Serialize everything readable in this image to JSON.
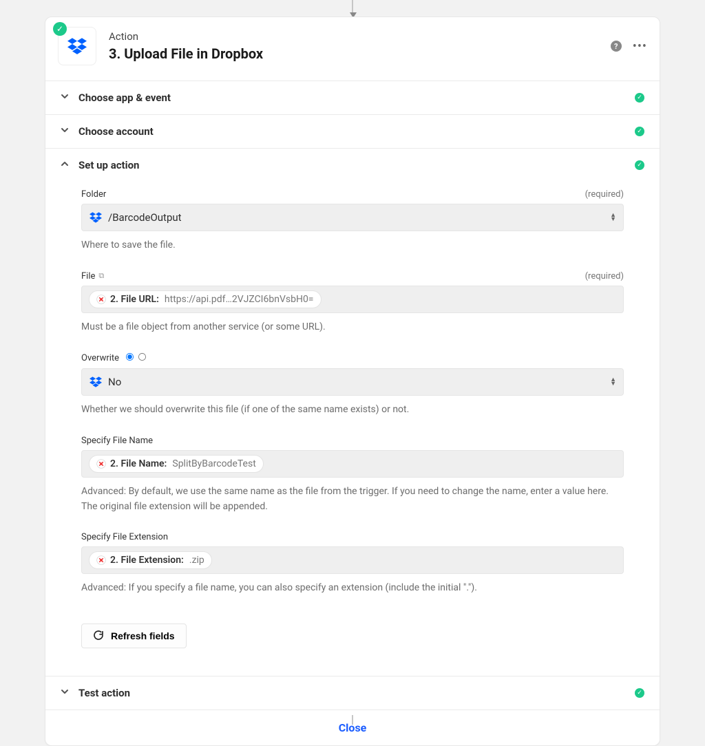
{
  "header": {
    "super": "Action",
    "title": "3. Upload File in Dropbox"
  },
  "sections": {
    "choose_app": {
      "label": "Choose app & event"
    },
    "choose_account": {
      "label": "Choose account"
    },
    "setup": {
      "label": "Set up action"
    },
    "test": {
      "label": "Test action"
    }
  },
  "fields": {
    "folder": {
      "label": "Folder",
      "required": "(required)",
      "value": "/BarcodeOutput",
      "helper": "Where to save the file."
    },
    "file": {
      "label": "File",
      "required": "(required)",
      "tag_label": "2. File URL:",
      "tag_value": "https://api.pdf…2VJZCI6bnVsbH0=",
      "helper": "Must be a file object from another service (or some URL)."
    },
    "overwrite": {
      "label": "Overwrite",
      "value": "No",
      "helper": "Whether we should overwrite this file (if one of the same name exists) or not."
    },
    "filename": {
      "label": "Specify File Name",
      "tag_label": "2. File Name:",
      "tag_value": "SplitByBarcodeTest",
      "helper": "Advanced: By default, we use the same name as the file from the trigger. If you need to change the name, enter a value here. The original file extension will be appended."
    },
    "fileext": {
      "label": "Specify File Extension",
      "tag_label": "2. File Extension:",
      "tag_value": ".zip",
      "helper": "Advanced: If you specify a file name, you can also specify an extension (include the initial \".\")."
    }
  },
  "buttons": {
    "refresh": "Refresh fields",
    "close": "Close"
  }
}
